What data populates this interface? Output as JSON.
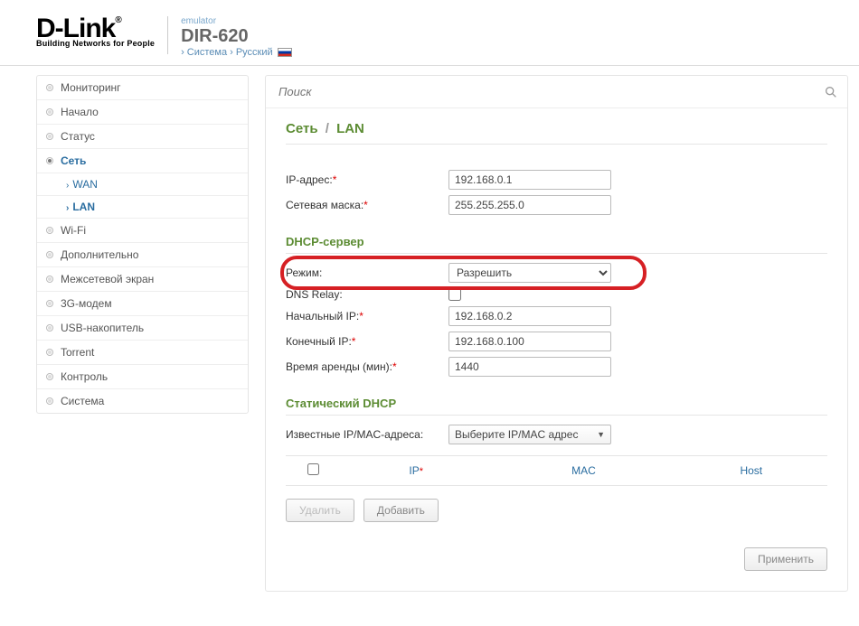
{
  "header": {
    "emulator": "emulator",
    "model": "DIR-620",
    "crumb_system": "Система",
    "crumb_lang": "Русский",
    "logo_tag": "Building Networks for People"
  },
  "sidebar": {
    "items": [
      {
        "label": "Мониторинг"
      },
      {
        "label": "Начало"
      },
      {
        "label": "Статус"
      },
      {
        "label": "Сеть",
        "active": true,
        "subs": [
          {
            "label": "WAN"
          },
          {
            "label": "LAN",
            "active": true
          }
        ]
      },
      {
        "label": "Wi-Fi"
      },
      {
        "label": "Дополнительно"
      },
      {
        "label": "Межсетевой экран"
      },
      {
        "label": "3G-модем"
      },
      {
        "label": "USB-накопитель"
      },
      {
        "label": "Torrent"
      },
      {
        "label": "Контроль"
      },
      {
        "label": "Система"
      }
    ]
  },
  "search": {
    "placeholder": "Поиск"
  },
  "page": {
    "crumb_net": "Сеть",
    "crumb_lan": "LAN",
    "ip_label": "IP-адрес:",
    "ip_value": "192.168.0.1",
    "mask_label": "Сетевая маска:",
    "mask_value": "255.255.255.0",
    "dhcp_title": "DHCP-сервер",
    "mode_label": "Режим:",
    "mode_value": "Разрешить",
    "dns_label": "DNS Relay:",
    "start_label": "Начальный IP:",
    "start_value": "192.168.0.2",
    "end_label": "Конечный IP:",
    "end_value": "192.168.0.100",
    "lease_label": "Время аренды (мин):",
    "lease_value": "1440",
    "static_title": "Статический DHCP",
    "known_label": "Известные IP/MAC-адреса:",
    "known_value": "Выберите IP/MAC адрес",
    "th_ip": "IP",
    "th_mac": "MAC",
    "th_host": "Host",
    "btn_delete": "Удалить",
    "btn_add": "Добавить",
    "btn_apply": "Применить"
  }
}
